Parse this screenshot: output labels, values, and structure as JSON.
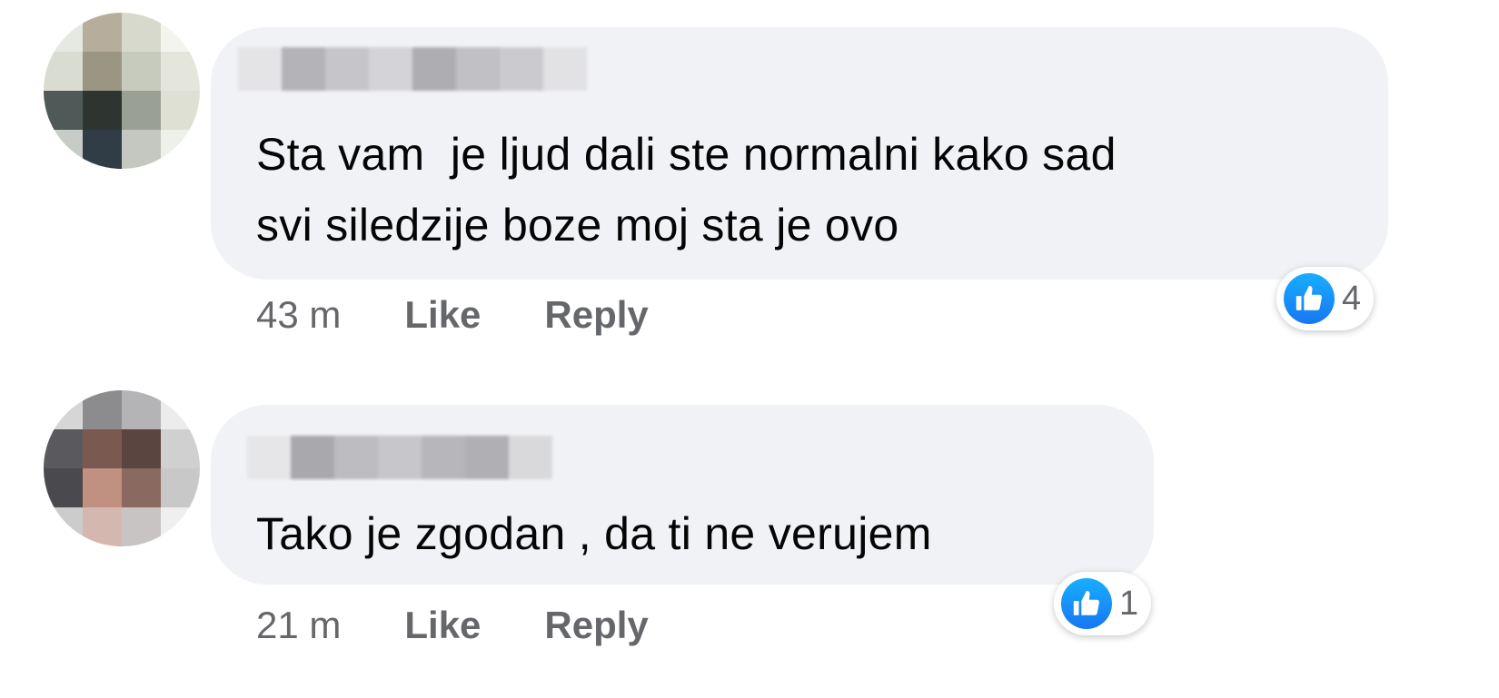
{
  "comments": [
    {
      "text_line1": "Sta vam  je ljud dali ste normalni kako sad",
      "text_line2": "svi siledzije boze moj sta je ovo",
      "time": "43 m",
      "like_label": "Like",
      "reply_label": "Reply",
      "reaction_icon": "thumbs-up-icon",
      "reaction_count": "4"
    },
    {
      "text_line1": "Tako je zgodan , da ti ne verujem",
      "time": "21 m",
      "like_label": "Like",
      "reply_label": "Reply",
      "reaction_icon": "thumbs-up-icon",
      "reaction_count": "1"
    }
  ],
  "colors": {
    "bubble": "#f0f2f5",
    "meta_text": "#65676b",
    "like_blue": "#1877f2"
  }
}
